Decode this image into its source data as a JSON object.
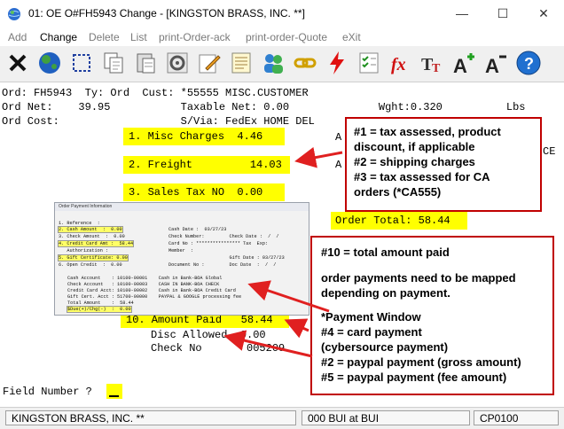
{
  "window": {
    "title": "01: OE O#FH5943    Change - [KINGSTON BRASS, INC. **]",
    "minimize": "—",
    "maximize": "☐",
    "close": "✕"
  },
  "menu": [
    {
      "label": "Add"
    },
    {
      "label": "Change"
    },
    {
      "label": "Delete"
    },
    {
      "label": "List"
    },
    {
      "label": "print-Order-ack"
    },
    {
      "label": "print-order-Quote"
    },
    {
      "label": "eXit"
    }
  ],
  "toolbar_icons": [
    "close-icon",
    "globe-icon",
    "select-icon",
    "copy-icon",
    "paste-icon",
    "settings-icon",
    "edit-icon",
    "notes-icon",
    "users-icon",
    "link-icon",
    "lightning-icon",
    "checklist-icon",
    "fx-icon",
    "text-style-icon",
    "font-increase-icon",
    "font-decrease-icon",
    "help-icon"
  ],
  "header": {
    "line1": "Ord: FH5943  Ty: Ord  Cust: *55555 MISC.CUSTOMER",
    "line2": "Ord Net:    39.95           Taxable Net: 0.00              Wght:0.320          Lbs",
    "line3": "Ord Cost:                   S/Via: FedEx HOME DEL",
    "frag_a1": "A",
    "frag_a2": "A",
    "frag_ce": "CE"
  },
  "fields": {
    "misc_charges": "1. Misc Charges  4.46",
    "freight": "2. Freight         14.03",
    "sales_tax": "3. Sales Tax NO  0.00",
    "order_total": "Order Total: 58.44",
    "amount_paid": "10. Amount Paid   58.44",
    "disc_allowed": "Disc Allowed  0.00",
    "check_no": "Check No       005209"
  },
  "payment_window": {
    "title": "Order Payment Information",
    "left": [
      "1. Reference  :",
      "2. Cash Amount  :  0.00",
      "3. Check Amount  :  0.00",
      "4. Credit Card Amt :  58.44",
      "   Authorization :",
      "5. Gift Certificate: 0.00",
      "6. Open Credit  :  0.00"
    ],
    "right": [
      "Cash Date :  03/27/23",
      "Check Number:         Check Date :  /  /",
      "Card No : **************** Tax  Exp:",
      "Member  :",
      "                      Gift Date : 03/27/23",
      "Document No :         Doc Date  :  /  /"
    ],
    "accounts": [
      "Cash Account    : 10100-00001    Cash in Bank-BOA Global",
      "Check Account   : 10100-00003    CASH IN BANK-BOA CHECK",
      "Credit Card Acct: 10100-00002    Cash in Bank-BOA Credit Card",
      "Gift Cert. Acct : 51700-00000    PAYPAL & GOOGLE processing fee",
      "Total Amount    :  58.44",
      "$Due(+)/Chg(-)  :  0.00"
    ]
  },
  "callouts": {
    "c1": [
      "#1 = tax assessed, product",
      "discount, if applicable",
      "#2 = shipping charges",
      "#3 =  tax assessed for CA",
      "orders (*CA555)"
    ],
    "c2_title": "#10 = total amount paid",
    "c2_body": [
      "order payments need to be mapped",
      "depending on payment."
    ],
    "c2_pw": "*Payment Window",
    "c2_items": [
      "#4 = card payment",
      "(cybersource payment)",
      "#2 = paypal payment (gross amount)",
      "#5 = paypal payment (fee amount)"
    ]
  },
  "prompt": {
    "label": "Field Number ?"
  },
  "statusbar": {
    "company": "KINGSTON BRASS, INC. **",
    "user": "000 BUI at BUI",
    "code": "CP0100"
  },
  "colors": {
    "highlight": "#ffff00",
    "callout_border": "#c00000",
    "arrow": "#e02020"
  }
}
